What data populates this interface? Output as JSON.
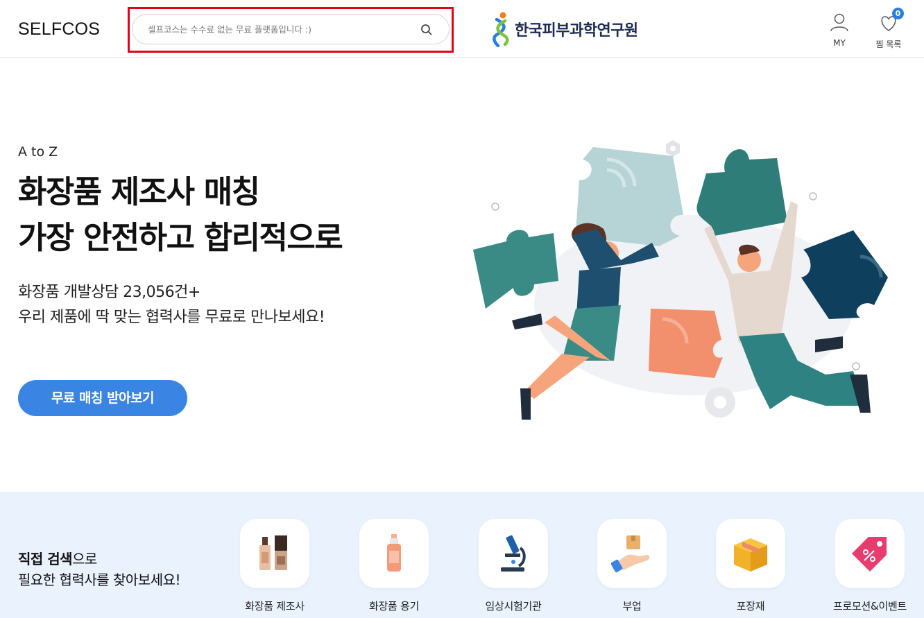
{
  "header": {
    "logo": "SELFCOS",
    "search": {
      "placeholder": "셀프코스는 수수료 없는 무료 플랫폼입니다 :)",
      "value": ""
    },
    "partner_name": "한국피부과학연구원",
    "my_label": "MY",
    "wishlist_label": "찜 목록",
    "wishlist_count": "0",
    "highlight_color": "#e60012"
  },
  "hero": {
    "eyebrow": "A to Z",
    "headline_line1": "화장품 제조사 매칭",
    "headline_line2": "가장 안전하고 합리적으로",
    "sub_line1": "화장품 개발상담 23,056건+",
    "sub_line2": "우리 제품에 딱 맞는 협력사를 무료로 만나보세요!",
    "cta_label": "무료 매칭 받아보기",
    "cta_color": "#3a84e4"
  },
  "categories": {
    "title_bold": "직접 검색",
    "title_rest": "으로",
    "title_line2": "필요한 협력사를 찾아보세요!",
    "items": [
      {
        "label": "화장품 제조사",
        "icon": "foundation-bottles-icon"
      },
      {
        "label": "화장품 용기",
        "icon": "pump-bottle-icon"
      },
      {
        "label": "임상시험기관",
        "icon": "microscope-icon"
      },
      {
        "label": "부업",
        "icon": "hand-box-icon"
      },
      {
        "label": "포장재",
        "icon": "package-box-icon"
      },
      {
        "label": "프로모션&이벤트",
        "icon": "discount-tag-icon"
      }
    ],
    "strip_color": "#eaf2fd"
  }
}
